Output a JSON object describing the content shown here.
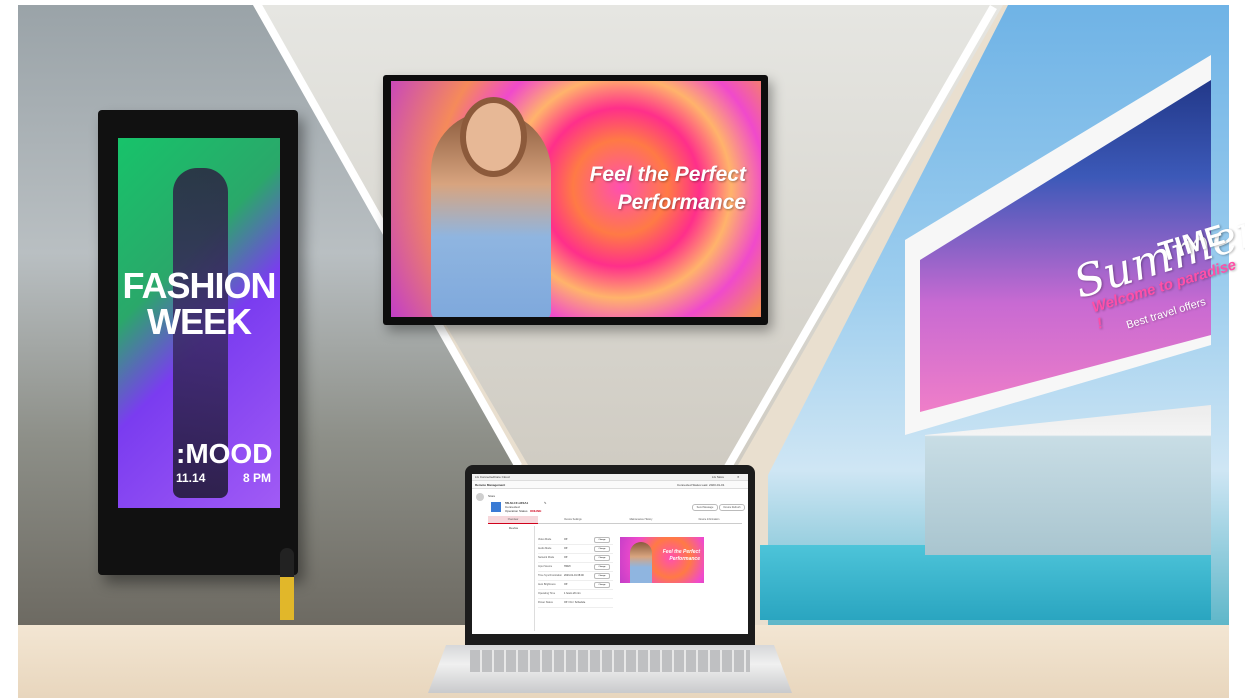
{
  "scene": {
    "kiosk": {
      "title_line1": "FASHION",
      "title_line2": "WEEK",
      "mood": ":MOOD",
      "date": "11.14",
      "time": "8 PM"
    },
    "wall_display": {
      "line1": "Feel the Perfect",
      "line2": "Performance"
    },
    "billboard": {
      "title": "Summer",
      "title_right": "TIME",
      "subtitle": "Welcome to paradise !",
      "offer": "Best travel offers"
    }
  },
  "laptop_app": {
    "window_title": "LG ConnectedCare Cloud",
    "window_right": "LG Store",
    "app_title": "Remote Management",
    "header_right": "Connected Status  Last: 2023-01-01",
    "sidebar_label": "Store",
    "device": {
      "name": "55LM-CF-HF0A1",
      "status": "Connected",
      "status_label": "Operation Status",
      "status_value": "ONLINE"
    },
    "actions": {
      "left": "Send Message",
      "right": "Device Refresh"
    },
    "tabs": [
      "Overview",
      "Device Settings",
      "Maintenance History",
      "Device Information"
    ],
    "sidebar_items": [
      "Device"
    ],
    "rows": [
      {
        "label": "Video Mode",
        "value": "Off",
        "action": "Change"
      },
      {
        "label": "Audio Mode",
        "value": "Off",
        "action": "Change"
      },
      {
        "label": "Network Mode",
        "value": "Off",
        "action": "Change"
      },
      {
        "label": "Input Source",
        "value": "HDMI",
        "action": "Change"
      },
      {
        "label": "Time Synchronization",
        "value": "2023-01-01 08:00",
        "action": "Change"
      },
      {
        "label": "Auto Brightness",
        "value": "Off",
        "action": "Change"
      },
      {
        "label": "Operating Time",
        "value": "1 hours 20 min",
        "action": ""
      },
      {
        "label": "Power Status",
        "value": "Off / On / Schedule",
        "action": ""
      }
    ],
    "preview": {
      "line1": "Feel the Perfect",
      "line2": "Performance"
    }
  }
}
